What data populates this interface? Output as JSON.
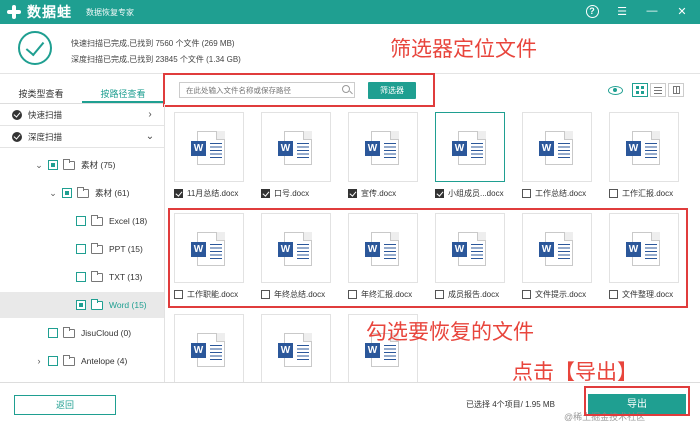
{
  "app": {
    "name": "数据蛙",
    "subtitle": "数据恢复专家"
  },
  "scan": {
    "quick_result": "快速扫描已完成,已找到 7560 个文件 (269 MB)",
    "deep_result": "深度扫描已完成,已找到 23845 个文件 (1.34 GB)"
  },
  "annotations": {
    "filter_hint": "筛选器定位文件",
    "select_hint": "勾选要恢复的文件",
    "export_hint": "点击【导出】"
  },
  "tabs": [
    {
      "label": "按类型查看",
      "active": false
    },
    {
      "label": "按路径查看",
      "active": true
    }
  ],
  "sidebar": {
    "quick_scan": "快速扫描",
    "deep_scan": "深度扫描",
    "tree": [
      {
        "label": "素材 (75)"
      },
      {
        "label": "素材 (61)"
      },
      {
        "label": "Excel (18)"
      },
      {
        "label": "PPT (15)"
      },
      {
        "label": "TXT (13)"
      },
      {
        "label": "Word (15)"
      },
      {
        "label": "JisuCloud (0)"
      },
      {
        "label": "Antelope (4)"
      }
    ]
  },
  "search": {
    "placeholder": "在此处输入文件名称或保存路径",
    "filter_label": "筛选器"
  },
  "files": [
    {
      "name": "11月总结.docx",
      "checked": true
    },
    {
      "name": "口号.docx",
      "checked": true
    },
    {
      "name": "宣传.docx",
      "checked": true
    },
    {
      "name": "小组成员...docx",
      "checked": true
    },
    {
      "name": "工作总结.docx",
      "checked": false
    },
    {
      "name": "工作汇报.docx",
      "checked": false
    },
    {
      "name": "工作职能.docx",
      "checked": false
    },
    {
      "name": "年终总结.docx",
      "checked": false
    },
    {
      "name": "年终汇报.docx",
      "checked": false
    },
    {
      "name": "成员报告.docx",
      "checked": false
    },
    {
      "name": "文件提示.docx",
      "checked": false
    },
    {
      "name": "文件整理.docx",
      "checked": false
    },
    {
      "name": "",
      "checked": false
    },
    {
      "name": "",
      "checked": false
    },
    {
      "name": "",
      "checked": false
    }
  ],
  "footer": {
    "back_label": "返回",
    "selection_info": "已选择 4个项目/ 1.95 MB",
    "export_label": "导出",
    "watermark": "@稀土掘金技术社区"
  },
  "colors": {
    "brand": "#1f9f91",
    "annotation": "#e8453c"
  }
}
